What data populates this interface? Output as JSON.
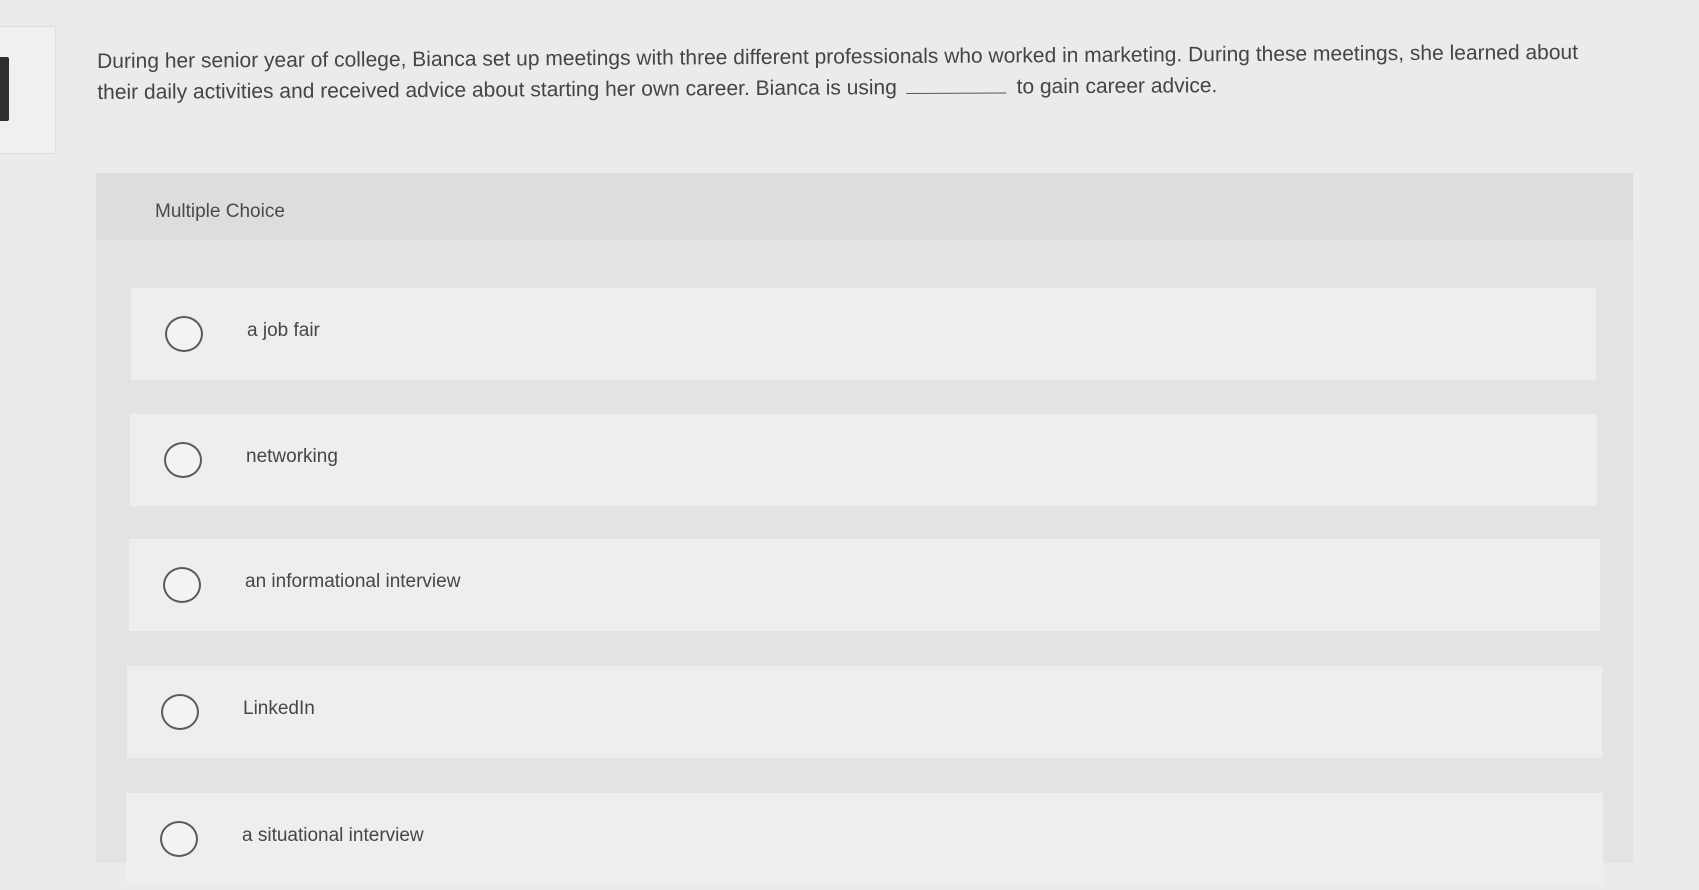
{
  "question": {
    "text_before_blank": "During her senior year of college, Bianca set up meetings with three different professionals who worked in marketing. During these meetings, she learned about their daily activities and received advice about starting her own career. Bianca is using",
    "text_after_blank": "to gain career advice."
  },
  "multiple_choice": {
    "label": "Multiple Choice",
    "options": [
      {
        "label": "a job fair"
      },
      {
        "label": "networking"
      },
      {
        "label": "an informational interview"
      },
      {
        "label": "LinkedIn"
      },
      {
        "label": "a situational interview"
      }
    ]
  }
}
